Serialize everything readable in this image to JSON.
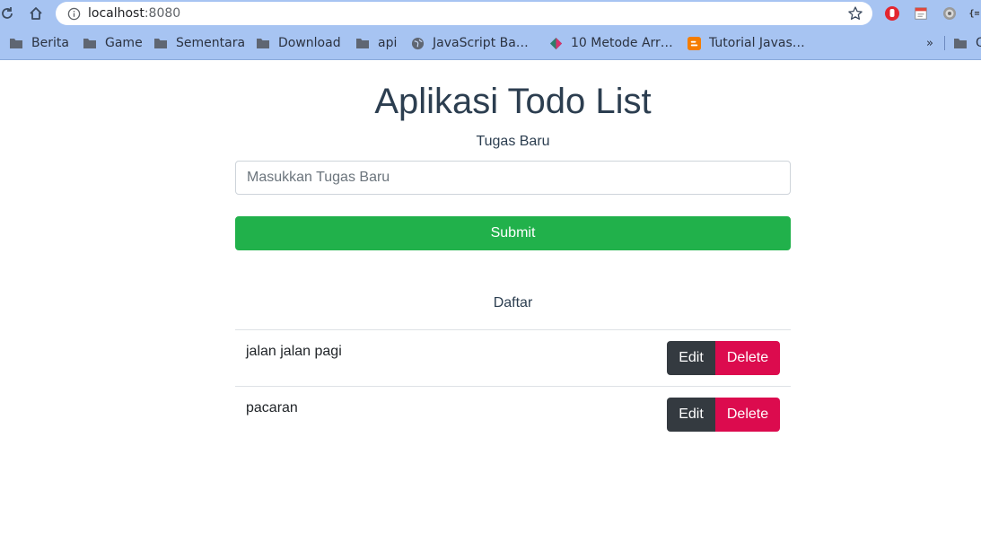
{
  "browser": {
    "url_host": "localhost",
    "url_port": ":8080",
    "bookmarks": [
      {
        "label": "Berita",
        "icon": "folder-icon"
      },
      {
        "label": "Game",
        "icon": "folder-icon"
      },
      {
        "label": "Sementara",
        "icon": "folder-icon"
      },
      {
        "label": "Download",
        "icon": "folder-icon"
      },
      {
        "label": "api",
        "icon": "folder-icon"
      },
      {
        "label": "JavaScript Ba…",
        "icon": "globe-icon"
      },
      {
        "label": "10 Metode Arr…",
        "icon": "site-icon"
      },
      {
        "label": "Tutorial Javas…",
        "icon": "blogger-icon"
      }
    ],
    "overflow_label": "»",
    "last_bookmark_label": "O",
    "colors": {
      "chrome": "#a7c4f2"
    }
  },
  "app": {
    "title": "Aplikasi Todo List",
    "new_task_label": "Tugas Baru",
    "input_placeholder": "Masukkan Tugas Baru",
    "input_value": "",
    "submit_label": "Submit",
    "list_title": "Daftar",
    "items": [
      {
        "text": "jalan jalan pagi",
        "edit_label": "Edit",
        "delete_label": "Delete"
      },
      {
        "text": "pacaran",
        "edit_label": "Edit",
        "delete_label": "Delete"
      }
    ],
    "colors": {
      "submit": "#21b14b",
      "edit": "#343a40",
      "delete": "#dc0b4e",
      "title": "#2c3e50"
    }
  }
}
